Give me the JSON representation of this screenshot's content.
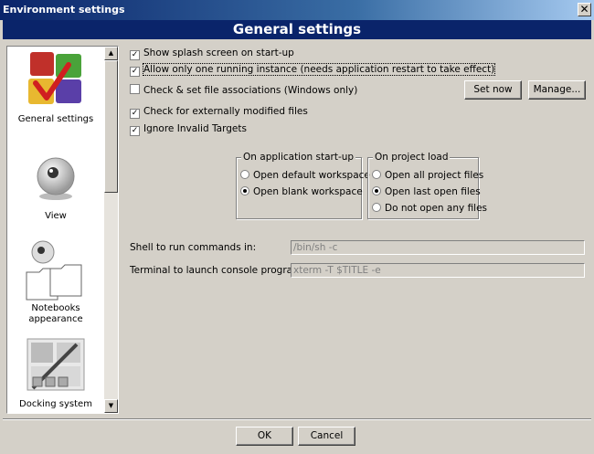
{
  "window": {
    "title": "Environment settings",
    "close_glyph": "✕"
  },
  "header": {
    "title": "General settings"
  },
  "sidebar": {
    "items": [
      {
        "label": "General settings",
        "icon": "general-settings-icon"
      },
      {
        "label": "View",
        "icon": "view-eye-icon"
      },
      {
        "label": "Notebooks\nappearance",
        "label_line1": "Notebooks",
        "label_line2": "appearance",
        "icon": "notebooks-icon"
      },
      {
        "label": "Docking system",
        "icon": "docking-system-icon"
      }
    ],
    "scroll_up": "▲",
    "scroll_down": "▼"
  },
  "options": {
    "splash": {
      "label": "Show splash screen on start-up",
      "checked": true
    },
    "single_instance": {
      "label": "Allow only one running instance (needs application restart to take effect)",
      "checked": true
    },
    "file_assoc": {
      "label": "Check & set file associations (Windows only)",
      "checked": false
    },
    "modified_files": {
      "label": "Check for externally modified files",
      "checked": true
    },
    "ignore_invalid": {
      "label": "Ignore Invalid Targets",
      "checked": true
    }
  },
  "buttons": {
    "set_now": "Set now",
    "manage": "Manage...",
    "ok": "OK",
    "cancel": "Cancel"
  },
  "startup_group": {
    "legend": "On application start-up",
    "options": [
      "Open default workspace",
      "Open blank workspace"
    ],
    "selected": 1
  },
  "project_group": {
    "legend": "On project load",
    "options": [
      "Open all project files",
      "Open last open files",
      "Do not open any files"
    ],
    "selected": 1
  },
  "shell": {
    "label": "Shell to run commands in:",
    "value": "/bin/sh -c"
  },
  "terminal": {
    "label": "Terminal to launch console programs:",
    "value": "xterm -T $TITLE -e"
  },
  "colors": {
    "title_bar": "#0a246a",
    "header_bg": "#0a246a",
    "window_bg": "#d4d0c8"
  }
}
